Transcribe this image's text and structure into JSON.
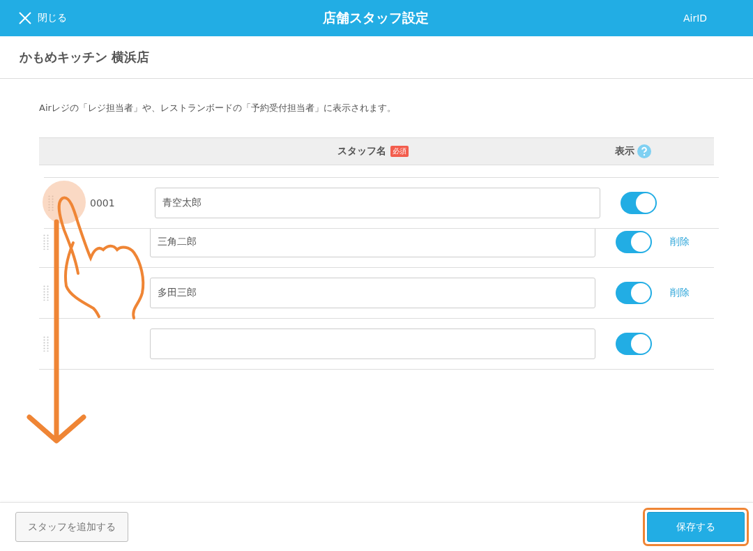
{
  "header": {
    "close_label": "閉じる",
    "title": "店舗スタッフ設定",
    "account_label": "AirID"
  },
  "store_name": "かもめキッチン 横浜店",
  "description": "Airレジの「レジ担当者」や、レストランボードの「予約受付担当者」に表示されます。",
  "table": {
    "columns": [
      {
        "label": "スタッフ名",
        "badge": "必須"
      },
      {
        "label": "表示",
        "help": true
      }
    ],
    "rows": [
      {
        "id": "0001",
        "name": "青空太郎",
        "visible": true,
        "dragging": true
      },
      {
        "name": "三角二郎",
        "visible": true,
        "dragging": false,
        "delete_label": "削除"
      },
      {
        "name": "多田三郎",
        "visible": true,
        "dragging": false,
        "delete_label": "削除"
      },
      {
        "name": "",
        "visible": true,
        "dragging": false
      }
    ]
  },
  "footer": {
    "add_button": "スタッフを追加する",
    "save_button": "保存する",
    "save_highlighted": true
  },
  "gesture": {
    "kind": "drag-down"
  }
}
